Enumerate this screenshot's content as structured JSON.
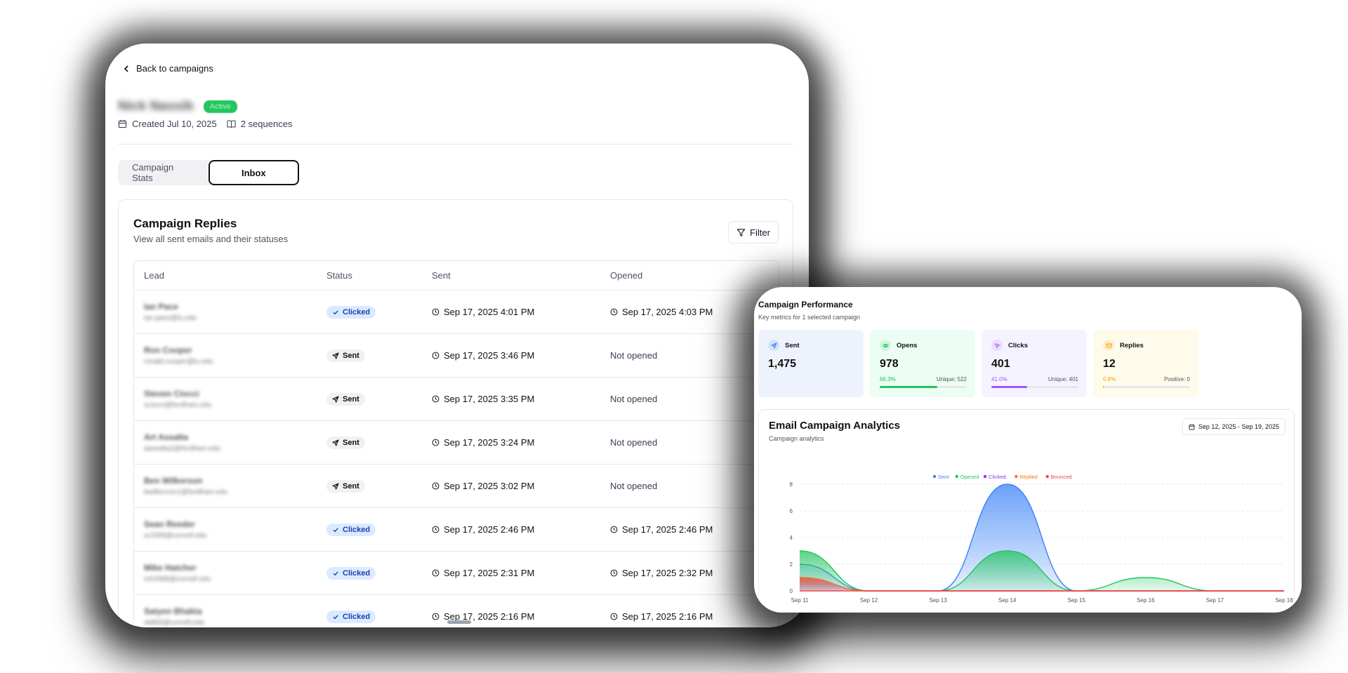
{
  "left": {
    "back_label": "Back to campaigns",
    "campaign_name": "Nick Nassib",
    "status_badge": "Active",
    "created": "Created Jul 10, 2025",
    "sequences": "2 sequences",
    "tabs": [
      "Campaign Stats",
      "Inbox"
    ],
    "card": {
      "title": "Campaign Replies",
      "subtitle": "View all sent emails and their statuses",
      "filter_label": "Filter"
    },
    "table": {
      "headers": [
        "Lead",
        "Status",
        "Sent",
        "Opened"
      ],
      "rows": [
        {
          "name": "Ian Pace",
          "email": "ian.pace@lu.edu",
          "status": "Clicked",
          "sent": "Sep 17, 2025 4:01 PM",
          "opened": "Sep 17, 2025 4:03 PM"
        },
        {
          "name": "Ron Cooper",
          "email": "ronald.cooper@lu.edu",
          "status": "Sent",
          "sent": "Sep 17, 2025 3:46 PM",
          "opened": "Not opened"
        },
        {
          "name": "Steven Ciocci",
          "email": "sciocci@fordham.edu",
          "status": "Sent",
          "sent": "Sep 17, 2025 3:35 PM",
          "opened": "Not opened"
        },
        {
          "name": "Art Assalta",
          "email": "aassalta2@fordham.edu",
          "status": "Sent",
          "sent": "Sep 17, 2025 3:24 PM",
          "opened": "Not opened"
        },
        {
          "name": "Ben Wilkerson",
          "email": "bwilkerson1@fordham.edu",
          "status": "Sent",
          "sent": "Sep 17, 2025 3:02 PM",
          "opened": "Not opened"
        },
        {
          "name": "Sean Reeder",
          "email": "sr2308@cornell.edu",
          "status": "Clicked",
          "sent": "Sep 17, 2025 2:46 PM",
          "opened": "Sep 17, 2025 2:46 PM"
        },
        {
          "name": "Mike Hatcher",
          "email": "mh2688@cornell.edu",
          "status": "Clicked",
          "sent": "Sep 17, 2025 2:31 PM",
          "opened": "Sep 17, 2025 2:32 PM"
        },
        {
          "name": "Satyen Bhakta",
          "email": "sb893@cornell.edu",
          "status": "Clicked",
          "sent": "Sep 17, 2025 2:16 PM",
          "opened": "Sep 17, 2025 2:16 PM"
        }
      ]
    }
  },
  "right": {
    "title": "Campaign Performance",
    "subtitle": "Key metrics for 1 selected campaign",
    "stats": [
      {
        "label": "Sent",
        "value": "1,475",
        "pct": "",
        "extra": "",
        "fill": 0,
        "color": "#3b82f6",
        "bg": "#eef2fd"
      },
      {
        "label": "Opens",
        "value": "978",
        "pct": "66.3%",
        "extra": "Unique: 522",
        "fill": 0.663,
        "color": "#22c55e",
        "bg": "#ecfdf3"
      },
      {
        "label": "Clicks",
        "value": "401",
        "pct": "41.0%",
        "extra": "Unique: 401",
        "fill": 0.41,
        "color": "#a855f7",
        "bg": "#f5f3ff"
      },
      {
        "label": "Replies",
        "value": "12",
        "pct": "0.8%",
        "extra": "Positive: 0",
        "fill": 0.008,
        "color": "#f59e0b",
        "bg": "#fffbeb"
      }
    ],
    "chart_title": "Email Campaign Analytics",
    "chart_subtitle": "Campaign analytics",
    "date_range": "Sep 12, 2025 - Sep 19, 2025"
  },
  "chart_data": {
    "type": "area",
    "categories": [
      "Sep 11",
      "Sep 12",
      "Sep 13",
      "Sep 14",
      "Sep 15",
      "Sep 16",
      "Sep 17",
      "Sep 18"
    ],
    "ylim": [
      0,
      8
    ],
    "yticks": [
      0,
      2,
      4,
      6,
      8
    ],
    "legend_position": "top-center",
    "grid": true,
    "series": [
      {
        "name": "Sent",
        "color": "#3b82f6",
        "values": [
          2,
          0,
          0,
          8,
          0,
          0,
          0,
          0
        ]
      },
      {
        "name": "Opened",
        "color": "#22c55e",
        "values": [
          3,
          0,
          0,
          3,
          0,
          1,
          0,
          0
        ]
      },
      {
        "name": "Clicked",
        "color": "#9333ea",
        "values": [
          1,
          0,
          0,
          0,
          0,
          0,
          0,
          0
        ]
      },
      {
        "name": "Replied",
        "color": "#f97316",
        "values": [
          1,
          0,
          0,
          0,
          0,
          0,
          0,
          0
        ]
      },
      {
        "name": "Bounced",
        "color": "#ef4444",
        "values": [
          0,
          0,
          0,
          0,
          0,
          0,
          0,
          0
        ]
      }
    ]
  }
}
